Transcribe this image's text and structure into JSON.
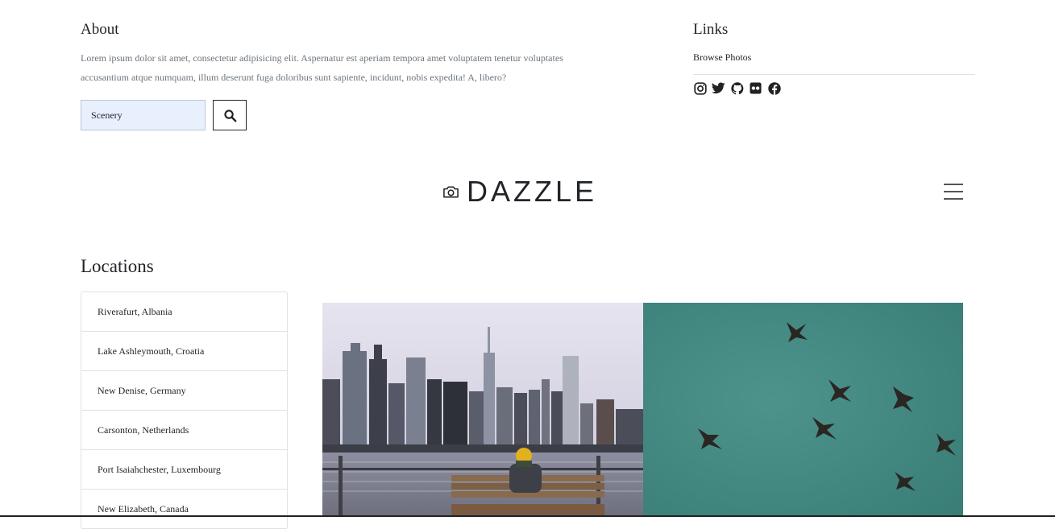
{
  "about": {
    "title": "About",
    "text": "Lorem ipsum dolor sit amet, consectetur adipisicing elit. Aspernatur est aperiam tempora amet voluptatem tenetur voluptates accusantium atque numquam, illum deserunt fuga doloribus sunt sapiente, incidunt, nobis expedita! A, libero?"
  },
  "search": {
    "value": "Scenery",
    "button_icon": "search-icon"
  },
  "links": {
    "title": "Links",
    "items": [
      {
        "label": "Browse Photos"
      }
    ],
    "social_icons": [
      "instagram-icon",
      "twitter-icon",
      "github-icon",
      "flickr-icon",
      "facebook-icon"
    ]
  },
  "header": {
    "brand": "DAZZLE",
    "brand_icon": "camera-icon",
    "menu_icon": "hamburger-menu-icon"
  },
  "locations": {
    "title": "Locations",
    "items": [
      {
        "label": "Riverafurt, Albania"
      },
      {
        "label": "Lake Ashleymouth, Croatia"
      },
      {
        "label": "New Denise, Germany"
      },
      {
        "label": "Carsonton, Netherlands"
      },
      {
        "label": "Port Isaiahchester, Luxembourg"
      },
      {
        "label": "New Elizabeth, Canada"
      }
    ]
  },
  "photos": [
    {
      "subject": "city-skyline-photo"
    },
    {
      "subject": "birds-flying-photo"
    }
  ],
  "colors": {
    "input_bg": "#e8f0fe",
    "text": "#212529",
    "muted": "#6c757d",
    "border": "#dee2e6",
    "teal_sky": "#3f8a84"
  }
}
